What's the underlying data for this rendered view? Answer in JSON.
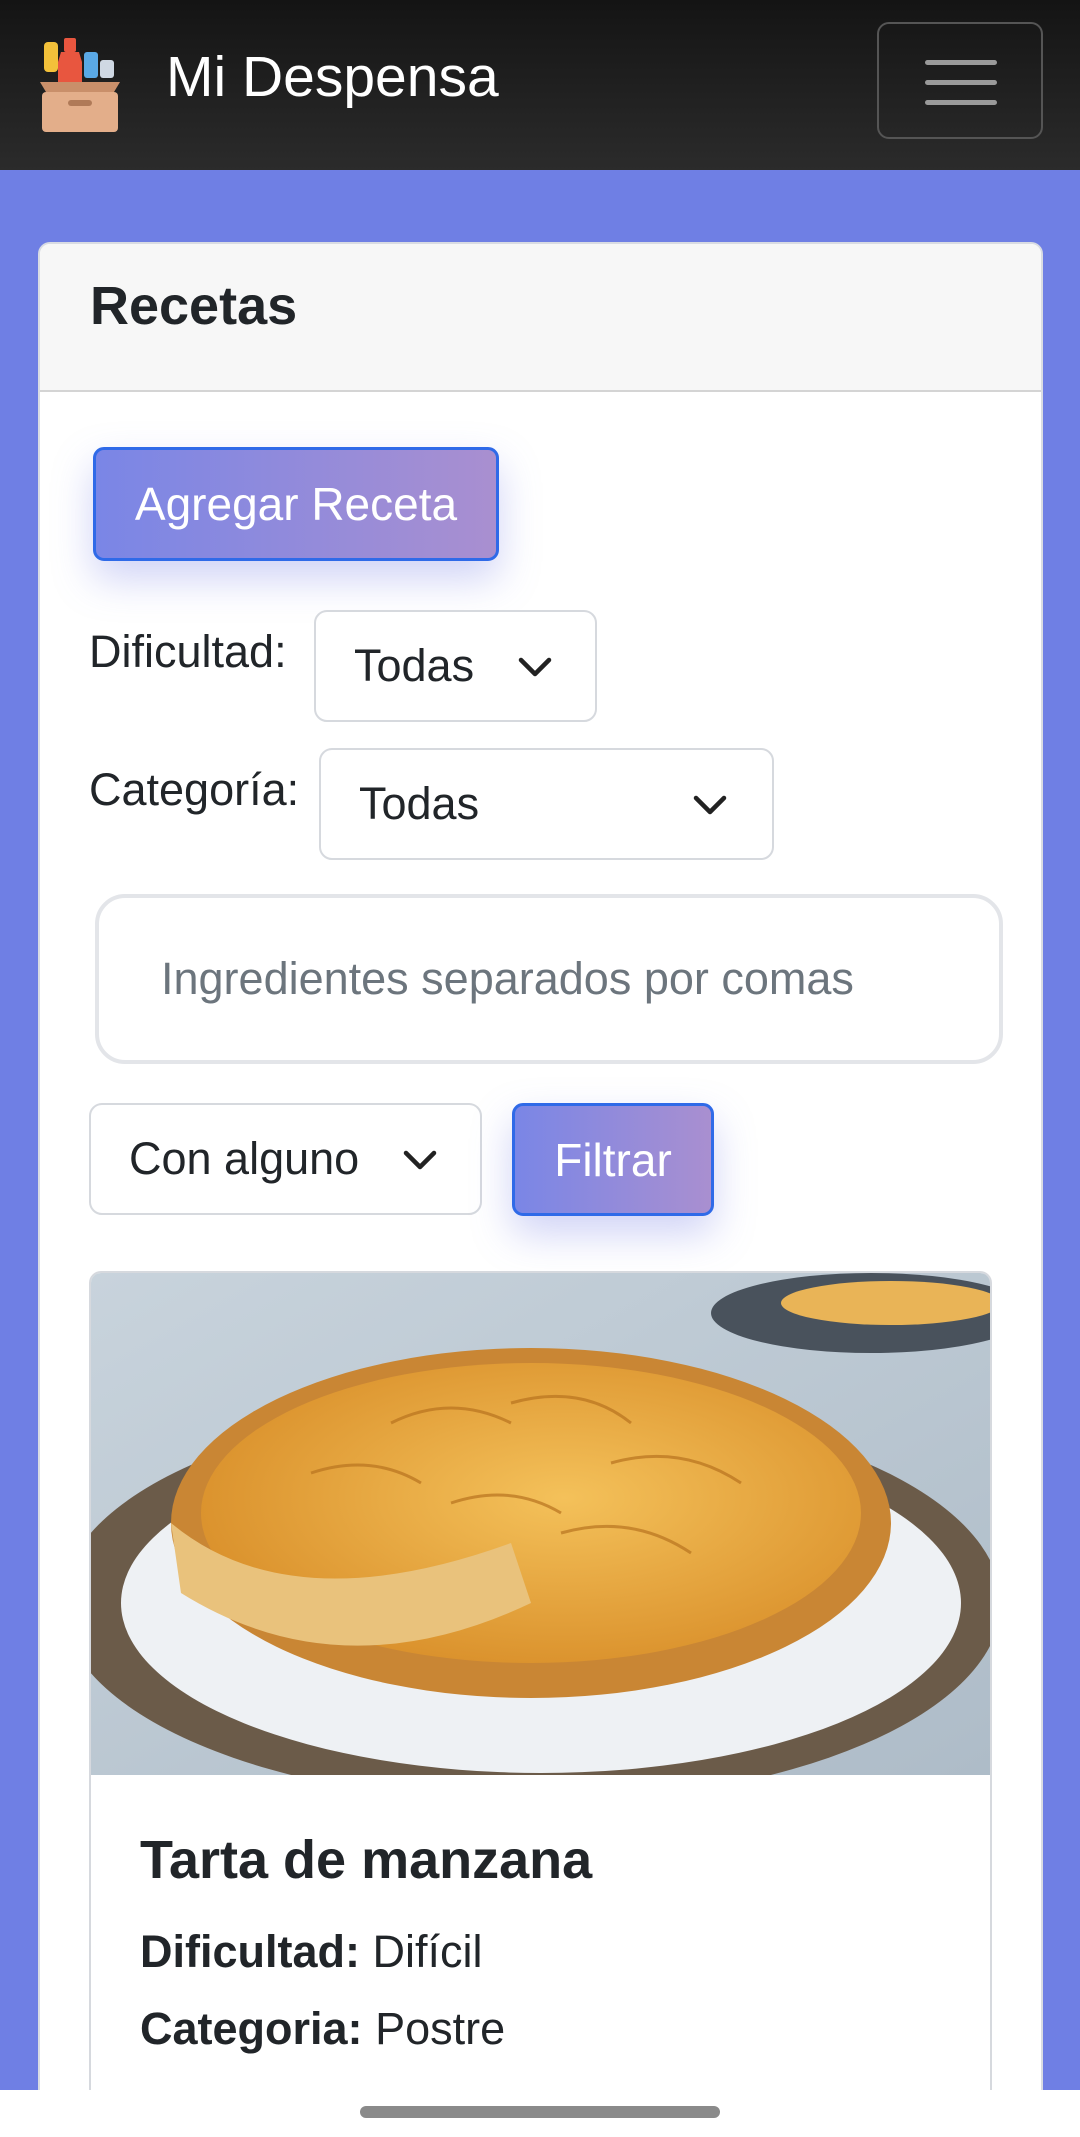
{
  "navbar": {
    "brand": "Mi Despensa",
    "logo_icon": "pantry-box-icon",
    "toggle_icon": "hamburger-menu-icon"
  },
  "card": {
    "title": "Recetas",
    "add_button": "Agregar Receta",
    "filters": {
      "difficulty_label": "Dificultad:",
      "difficulty_value": "Todas",
      "category_label": "Categoría:",
      "category_value": "Todas",
      "ingredients_placeholder": "Ingredientes separados por comas",
      "match_mode_value": "Con alguno",
      "filter_button": "Filtrar"
    }
  },
  "recipes": [
    {
      "title": "Tarta de manzana",
      "difficulty_label": "Dificultad:",
      "difficulty": "Difícil",
      "category_label": "Categoria:",
      "category": "Postre"
    }
  ],
  "colors": {
    "background": "#6f7fe4",
    "navbar": "#1f1f1f",
    "primary_gradient_start": "#7a86e6",
    "primary_gradient_end": "#a98fd0",
    "primary_border": "#2f6ae8"
  }
}
